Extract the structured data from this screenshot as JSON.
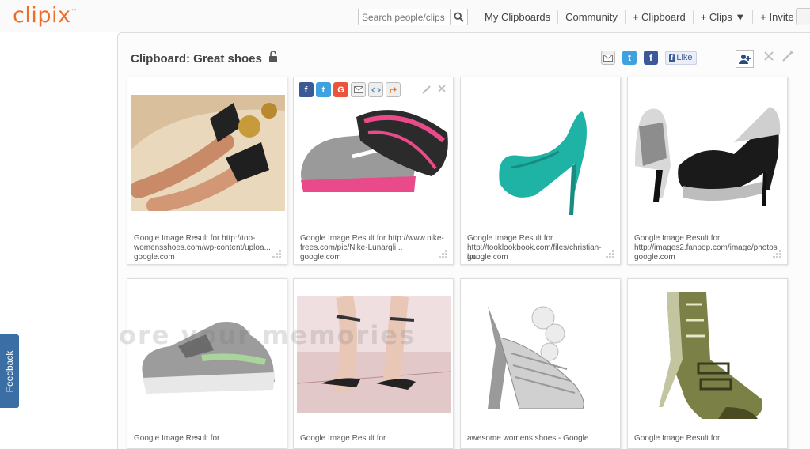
{
  "app": {
    "logo": "clipix",
    "logo_tm": "™"
  },
  "search": {
    "placeholder": "Search people/clips"
  },
  "nav": {
    "my_clipboards": "My Clipboards",
    "community": "Community",
    "add_clipboard": "+ Clipboard",
    "clips": "+ Clips ▼",
    "invite": "+ Invite ▼"
  },
  "feedback": {
    "label": "Feedback"
  },
  "board": {
    "title": "Clipboard: Great shoes",
    "like_label": "Like",
    "like_badge": "f"
  },
  "watermark": "ore your memories",
  "cards": [
    {
      "caption": "Google Image Result for http://top-womensshoes.com/wp-content/uploa...",
      "source": "google.com"
    },
    {
      "caption": "Google Image Result for http://www.nike-frees.com/pic/Nike-Lunargli...",
      "source": "google.com"
    },
    {
      "caption": "Google Image Result for http://tooklookbook.com/files/christian-lou...",
      "source": "google.com"
    },
    {
      "caption": "Google Image Result for http://images2.fanpop.com/image/photos",
      "source": "google.com"
    },
    {
      "caption": "Google Image Result for",
      "source": ""
    },
    {
      "caption": "Google Image Result for",
      "source": ""
    },
    {
      "caption": "awesome womens shoes - Google",
      "source": ""
    },
    {
      "caption": "Google Image Result for",
      "source": ""
    }
  ],
  "colors": {
    "brand_orange": "#ef6d2a",
    "facebook": "#3b5998",
    "twitter": "#3fa2e0",
    "feedback_tab": "#3b6ea5"
  }
}
